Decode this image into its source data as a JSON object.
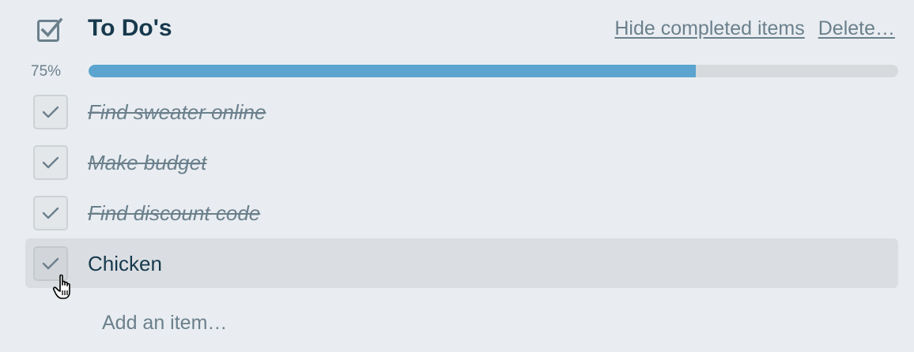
{
  "checklist": {
    "title": "To Do's",
    "actions": {
      "hide_completed": "Hide completed items",
      "delete": "Delete…"
    },
    "progress": {
      "percent_label": "75%",
      "fraction": 0.75,
      "fill_color": "#5ba4cf",
      "track_color": "#d6dadc"
    },
    "items": [
      {
        "label": "Find sweater online",
        "checked": true,
        "completed_style": true
      },
      {
        "label": "Make budget",
        "checked": true,
        "completed_style": true
      },
      {
        "label": "Find discount code",
        "checked": true,
        "completed_style": true
      },
      {
        "label": "Chicken",
        "checked": true,
        "completed_style": false,
        "hovered": true
      }
    ],
    "add_item": "Add an item…"
  },
  "icons": {
    "header": "checkbox-icon",
    "item_check": "checkmark-icon",
    "cursor": "hand-pointer-icon"
  },
  "colors": {
    "background": "#e9edf1",
    "title": "#17394d",
    "muted": "#6b808c"
  }
}
